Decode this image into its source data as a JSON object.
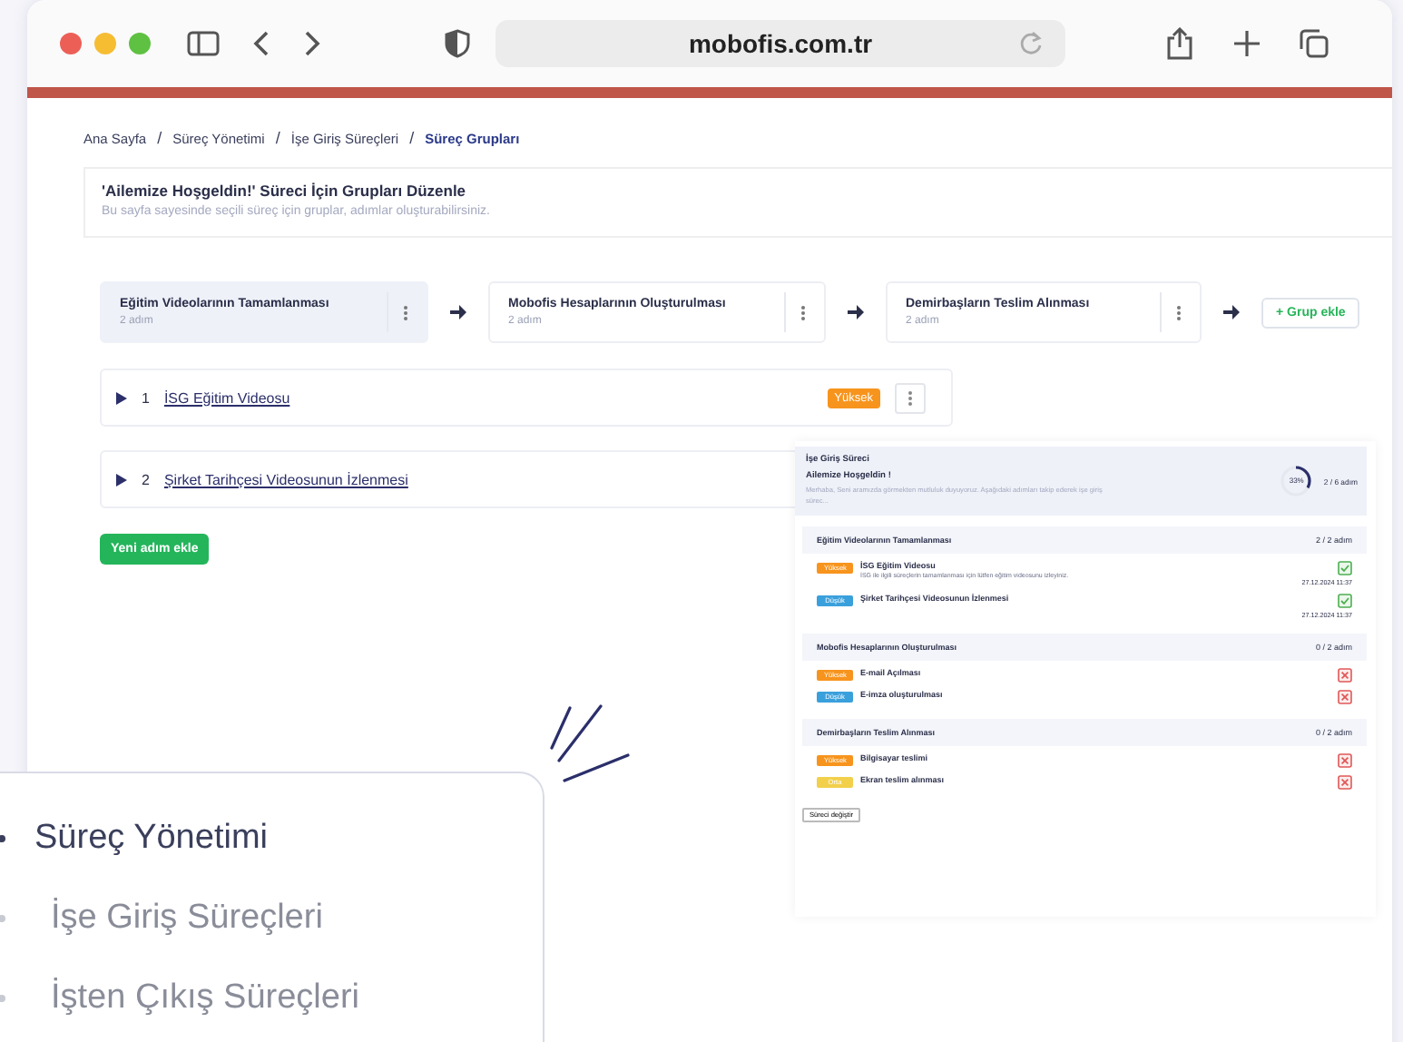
{
  "browser": {
    "url": "mobofis.com.tr"
  },
  "breadcrumb": [
    {
      "label": "Ana Sayfa",
      "current": false
    },
    {
      "separator": "/",
      "label": "Süreç Yönetimi",
      "current": false
    },
    {
      "separator": "/",
      "label": "İşe Giriş Süreçleri",
      "current": false
    },
    {
      "separator": "/",
      "label": "Süreç Grupları",
      "current": true
    }
  ],
  "header": {
    "title": "'Ailemize Hoşgeldin!' Süreci İçin Grupları Düzenle",
    "subtitle": "Bu sayfa sayesinde seçili süreç için gruplar, adımlar oluşturabilirsiniz."
  },
  "groups": [
    {
      "name": "Eğitim Videolarının Tamamlanması",
      "steps": "2 adım",
      "selected": true
    },
    {
      "name": "Mobofis Hesaplarının Oluşturulması",
      "steps": "2 adım",
      "selected": false
    },
    {
      "name": "Demirbaşların Teslim Alınması",
      "steps": "2 adım",
      "selected": false
    }
  ],
  "add_group_button": "+ Grup ekle",
  "steps": [
    {
      "number": "1",
      "title": "İSG Eğitim Videosu",
      "priority": "Yüksek",
      "color": "#f7941d"
    },
    {
      "number": "2",
      "title": "Şirket Tarihçesi Videosunun İzlenmesi"
    }
  ],
  "add_step_button": "Yeni adım ekle",
  "preview": {
    "process": "İşe Giriş Süreci",
    "title": "Ailemize Hoşgeldin !",
    "description": "Merhaba, Seni aramızda görmekten mutluluk duyuyoruz. Aşağıdaki adımları takip ederek işe giriş sürec...",
    "progress": "33%",
    "level": 0.33,
    "count": "2 / 6 adım",
    "groups": [
      {
        "name": "Eğitim Videolarının Tamamlanması",
        "count": "2 / 2 adım",
        "items": [
          {
            "priority": "Yüksek",
            "color": "#f7941d",
            "title": "İSG Eğitim Videosu",
            "description": "İSG ile ilgili süreçlerin tamamlanması için lütfen eğitim videosunu izleyiniz.",
            "done": true,
            "date": "27.12.2024 11:37"
          },
          {
            "priority": "Düşük",
            "color": "#3aa0dc",
            "title": "Şirket Tarihçesi Videosunun İzlenmesi",
            "done": true,
            "date": "27.12.2024 11:37"
          }
        ]
      },
      {
        "name": "Mobofis Hesaplarının Oluşturulması",
        "count": "0 / 2 adım",
        "items": [
          {
            "priority": "Yüksek",
            "color": "#f7941d",
            "title": "E-mail Açılması",
            "done": false
          },
          {
            "priority": "Düşük",
            "color": "#3aa0dc",
            "title": "E-imza oluşturulması",
            "done": false
          }
        ]
      },
      {
        "name": "Demirbaşların Teslim Alınması",
        "count": "0 / 2 adım",
        "items": [
          {
            "priority": "Yüksek",
            "color": "#f7941d",
            "title": "Bilgisayar teslimi",
            "done": false
          },
          {
            "priority": "Orta",
            "color": "#f2d04b",
            "title": "Ekran teslim alınması",
            "done": false
          }
        ]
      }
    ],
    "button": "Süreci değiştir"
  },
  "menu_overlay": {
    "items": [
      {
        "label": "Süreç Yönetimi",
        "children": [
          {
            "label": "İşe Giriş Süreçleri"
          },
          {
            "label": "İşten Çıkış Süreçleri"
          }
        ]
      }
    ]
  }
}
